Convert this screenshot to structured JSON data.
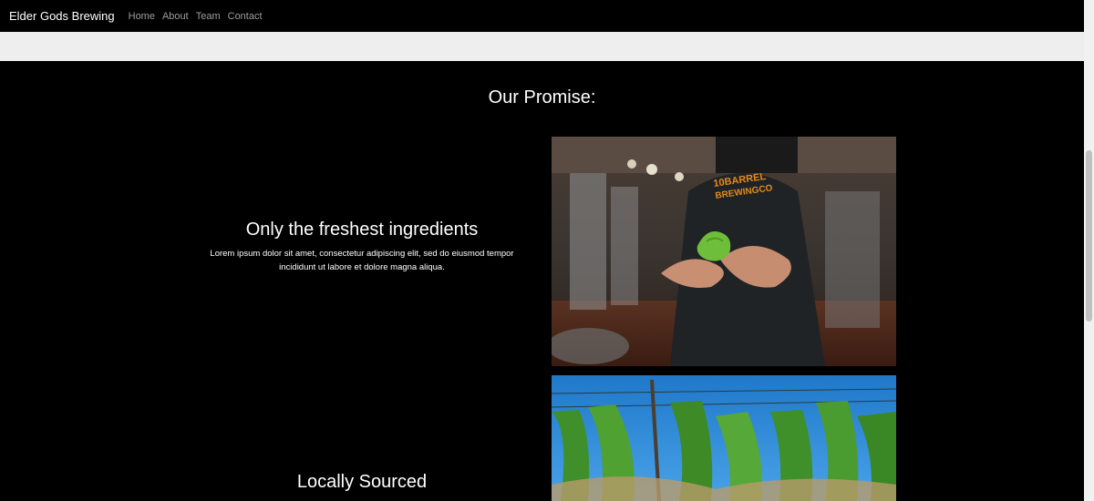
{
  "navbar": {
    "brand": "Elder Gods Brewing",
    "links": [
      "Home",
      "About",
      "Team",
      "Contact"
    ]
  },
  "promise": {
    "title": "Our Promise:",
    "features": [
      {
        "heading": "Only the freshest ingredients",
        "text": "Lorem ipsum dolor sit amet, consectetur adipiscing elit, sed do eiusmod tempor incididunt ut labore et dolore magna aliqua."
      },
      {
        "heading": "Locally Sourced"
      }
    ],
    "images": [
      {
        "shirt_text": "10 BARREL\nBREWING CO"
      },
      {}
    ]
  },
  "colors": {
    "background": "#000000",
    "nav_link": "#9d9d9d",
    "band": "#eeeeee",
    "sky": "#2a86d8",
    "hop_green": "#3f8f2a"
  }
}
